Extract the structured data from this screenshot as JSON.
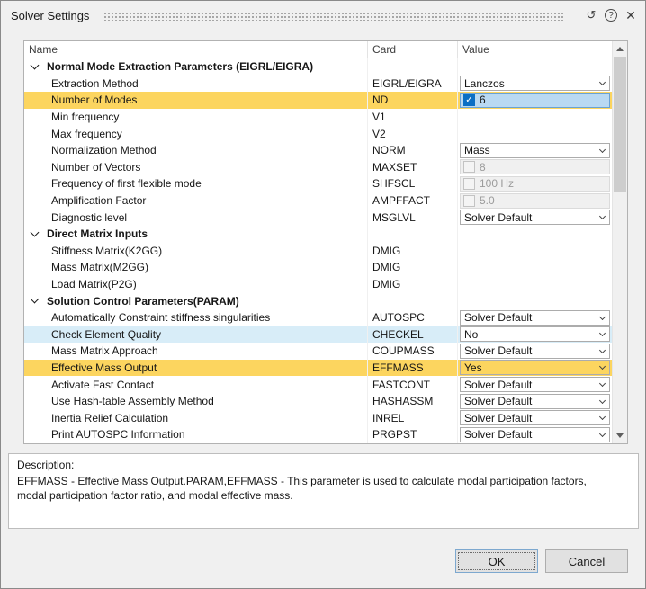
{
  "window": {
    "title": "Solver Settings",
    "icons": {
      "reset": "↺",
      "help": "?",
      "close": "✕"
    }
  },
  "colors": {
    "highlight_gold": "#fcd55f",
    "highlight_blue": "#d8edf8",
    "selected_value": "#b9d9f2",
    "checkbox_checked": "#0b6fc4",
    "dialog_bg": "#f0f0f0"
  },
  "table": {
    "columns": [
      "Name",
      "Card",
      "Value"
    ],
    "rows": [
      {
        "type": "group",
        "name": "Normal Mode Extraction Parameters (EIGRL/EIGRA)"
      },
      {
        "type": "item",
        "name": "Extraction Method",
        "card": "EIGRL/EIGRA",
        "value": {
          "kind": "dropdown",
          "text": "Lanczos"
        }
      },
      {
        "type": "item",
        "name": "Number of Modes",
        "card": "ND",
        "highlight": "gold",
        "value": {
          "kind": "checkedit",
          "text": "6",
          "checked": true,
          "selected": true
        }
      },
      {
        "type": "item",
        "name": "Min frequency",
        "card": "V1"
      },
      {
        "type": "item",
        "name": "Max frequency",
        "card": "V2"
      },
      {
        "type": "item",
        "name": "Normalization Method",
        "card": "NORM",
        "value": {
          "kind": "dropdown",
          "text": "Mass"
        }
      },
      {
        "type": "item",
        "name": "Number of Vectors",
        "card": "MAXSET",
        "value": {
          "kind": "checkedit",
          "text": "8",
          "checked": false,
          "disabled": true
        }
      },
      {
        "type": "item",
        "name": "Frequency of first flexible mode",
        "card": "SHFSCL",
        "value": {
          "kind": "checkedit",
          "text": "100 Hz",
          "checked": false,
          "disabled": true
        }
      },
      {
        "type": "item",
        "name": "Amplification Factor",
        "card": "AMPFFACT",
        "value": {
          "kind": "checkedit",
          "text": "5.0",
          "checked": false,
          "disabled": true
        }
      },
      {
        "type": "item",
        "name": "Diagnostic level",
        "card": "MSGLVL",
        "value": {
          "kind": "dropdown",
          "text": "Solver Default"
        }
      },
      {
        "type": "group",
        "name": "Direct Matrix Inputs"
      },
      {
        "type": "item",
        "name": "Stiffness Matrix(K2GG)",
        "card": "DMIG"
      },
      {
        "type": "item",
        "name": "Mass Matrix(M2GG)",
        "card": "DMIG"
      },
      {
        "type": "item",
        "name": "Load Matrix(P2G)",
        "card": "DMIG"
      },
      {
        "type": "group",
        "name": "Solution Control Parameters(PARAM)"
      },
      {
        "type": "item",
        "name": "Automatically Constraint stiffness singularities",
        "card": "AUTOSPC",
        "value": {
          "kind": "dropdown",
          "text": "Solver Default"
        }
      },
      {
        "type": "item",
        "name": "Check Element Quality",
        "card": "CHECKEL",
        "highlight": "blue",
        "value": {
          "kind": "dropdown",
          "text": "No"
        }
      },
      {
        "type": "item",
        "name": "Mass Matrix Approach",
        "card": "COUPMASS",
        "value": {
          "kind": "dropdown",
          "text": "Solver Default"
        }
      },
      {
        "type": "item",
        "name": "Effective Mass Output",
        "card": "EFFMASS",
        "highlight": "gold",
        "value": {
          "kind": "dropdown",
          "text": "Yes",
          "gold": true
        }
      },
      {
        "type": "item",
        "name": "Activate Fast Contact",
        "card": "FASTCONT",
        "value": {
          "kind": "dropdown",
          "text": "Solver Default"
        }
      },
      {
        "type": "item",
        "name": "Use Hash-table Assembly Method",
        "card": "HASHASSM",
        "value": {
          "kind": "dropdown",
          "text": "Solver Default"
        }
      },
      {
        "type": "item",
        "name": "Inertia Relief Calculation",
        "card": "INREL",
        "value": {
          "kind": "dropdown",
          "text": "Solver Default"
        }
      },
      {
        "type": "item",
        "name": "Print AUTOSPC Information",
        "card": "PRGPST",
        "value": {
          "kind": "dropdown",
          "text": "Solver Default"
        }
      }
    ]
  },
  "description": {
    "label": "Description:",
    "text": "EFFMASS - Effective Mass Output.PARAM,EFFMASS - This parameter is used to calculate modal participation factors, modal participation factor ratio, and modal effective mass."
  },
  "buttons": {
    "ok_label": "OK",
    "cancel_label": "Cancel"
  }
}
